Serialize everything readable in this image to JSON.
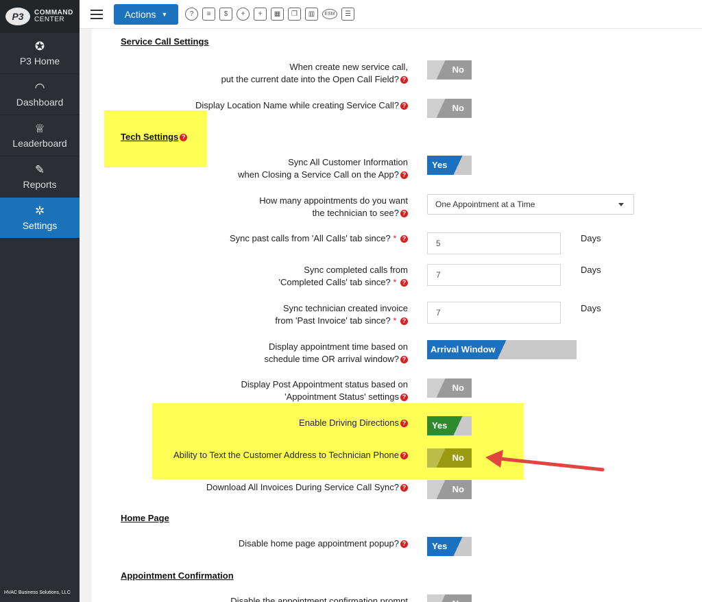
{
  "brand": {
    "logo_mark": "P3",
    "line1": "COMMAND",
    "line2": "CENTER",
    "footer": "HVAC Business Solutions, LLC"
  },
  "sidebar": {
    "items": [
      {
        "label": "P3 Home",
        "icon": "p3-home-icon",
        "glyph": "✪"
      },
      {
        "label": "Dashboard",
        "icon": "gauge-icon",
        "glyph": "◠"
      },
      {
        "label": "Leaderboard",
        "icon": "trophy-icon",
        "glyph": "♕"
      },
      {
        "label": "Reports",
        "icon": "report-edit-icon",
        "glyph": "✎"
      },
      {
        "label": "Settings",
        "icon": "gear-icon",
        "glyph": "✲"
      }
    ],
    "active": "Settings"
  },
  "topbar": {
    "actions_label": "Actions",
    "tools": [
      {
        "icon": "help-icon",
        "glyph": "?"
      },
      {
        "icon": "invoice-icon",
        "glyph": "≡"
      },
      {
        "icon": "estimate-icon",
        "glyph": "$"
      },
      {
        "icon": "add-user-icon",
        "glyph": "+"
      },
      {
        "icon": "calendar-add-icon",
        "glyph": "+"
      },
      {
        "icon": "calendar-icon",
        "glyph": "▦"
      },
      {
        "icon": "copy-docs-icon",
        "glyph": "❐"
      },
      {
        "icon": "bar-chart-icon",
        "glyph": "▥"
      },
      {
        "icon": "esm-icon",
        "glyph": "ESM"
      },
      {
        "icon": "checklist-icon",
        "glyph": "☰"
      }
    ]
  },
  "sections": {
    "service_call": "Service Call Settings",
    "tech": "Tech Settings",
    "home_page": "Home Page",
    "appointment_confirmation": "Appointment Confirmation"
  },
  "settings": {
    "open_call_date": {
      "line1": "When create new service call,",
      "line2": "put the current date into the Open Call Field?",
      "value": "No"
    },
    "display_location": {
      "label": "Display Location Name while creating Service Call?",
      "value": "No"
    },
    "sync_customer": {
      "line1": "Sync All Customer Information",
      "line2": "when Closing a Service Call on the App?",
      "value": "Yes"
    },
    "appointments_count": {
      "line1": "How many appointments do you want",
      "line2": "the technician to see?",
      "value": "One Appointment at a Time"
    },
    "sync_past": {
      "label": "Sync past calls from 'All Calls' tab since?",
      "value": "5",
      "unit": "Days"
    },
    "sync_completed": {
      "line1": "Sync completed calls from",
      "line2": "'Completed Calls' tab since?",
      "value": "7",
      "unit": "Days"
    },
    "sync_invoice": {
      "line1": "Sync technician created invoice",
      "line2": "from 'Past Invoice' tab since?",
      "value": "7",
      "unit": "Days"
    },
    "appt_time": {
      "line1": "Display appointment time based on",
      "line2": "schedule time OR arrival window?",
      "value": "Arrival Window"
    },
    "post_appt_status": {
      "line1": "Display Post Appointment status based on",
      "line2": "'Appointment Status' settings",
      "value": "No"
    },
    "driving_directions": {
      "label": "Enable Driving Directions",
      "value": "Yes"
    },
    "text_address": {
      "label": "Ability to Text the Customer Address to Technician Phone",
      "value": "No"
    },
    "download_invoices": {
      "label": "Download All Invoices During Service Call Sync?",
      "value": "No"
    },
    "disable_popup": {
      "label": "Disable home page appointment popup?",
      "value": "Yes"
    },
    "disable_confirm": {
      "label": "Disable the appointment confirmation prompt",
      "value": "No"
    }
  },
  "colors": {
    "accent": "#1c72bd",
    "highlight": "#ffff55",
    "arrow": "#e0453f",
    "required": "#d81e1e"
  }
}
